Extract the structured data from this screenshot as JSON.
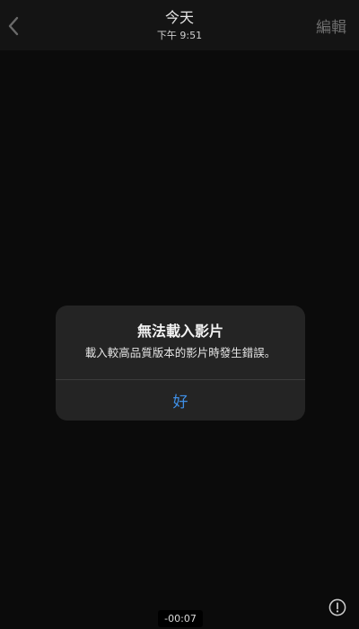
{
  "header": {
    "title": "今天",
    "subtitle": "下午 9:51",
    "edit_label": "編輯"
  },
  "alert": {
    "title": "無法載入影片",
    "message": "載入較高品質版本的影片時發生錯誤。",
    "button_label": "好",
    "accent_color": "#3f8fe6"
  },
  "player": {
    "remaining_time": "-00:07"
  },
  "icons": {
    "back": "chevron-left-icon",
    "info": "exclamation-circle-icon"
  }
}
